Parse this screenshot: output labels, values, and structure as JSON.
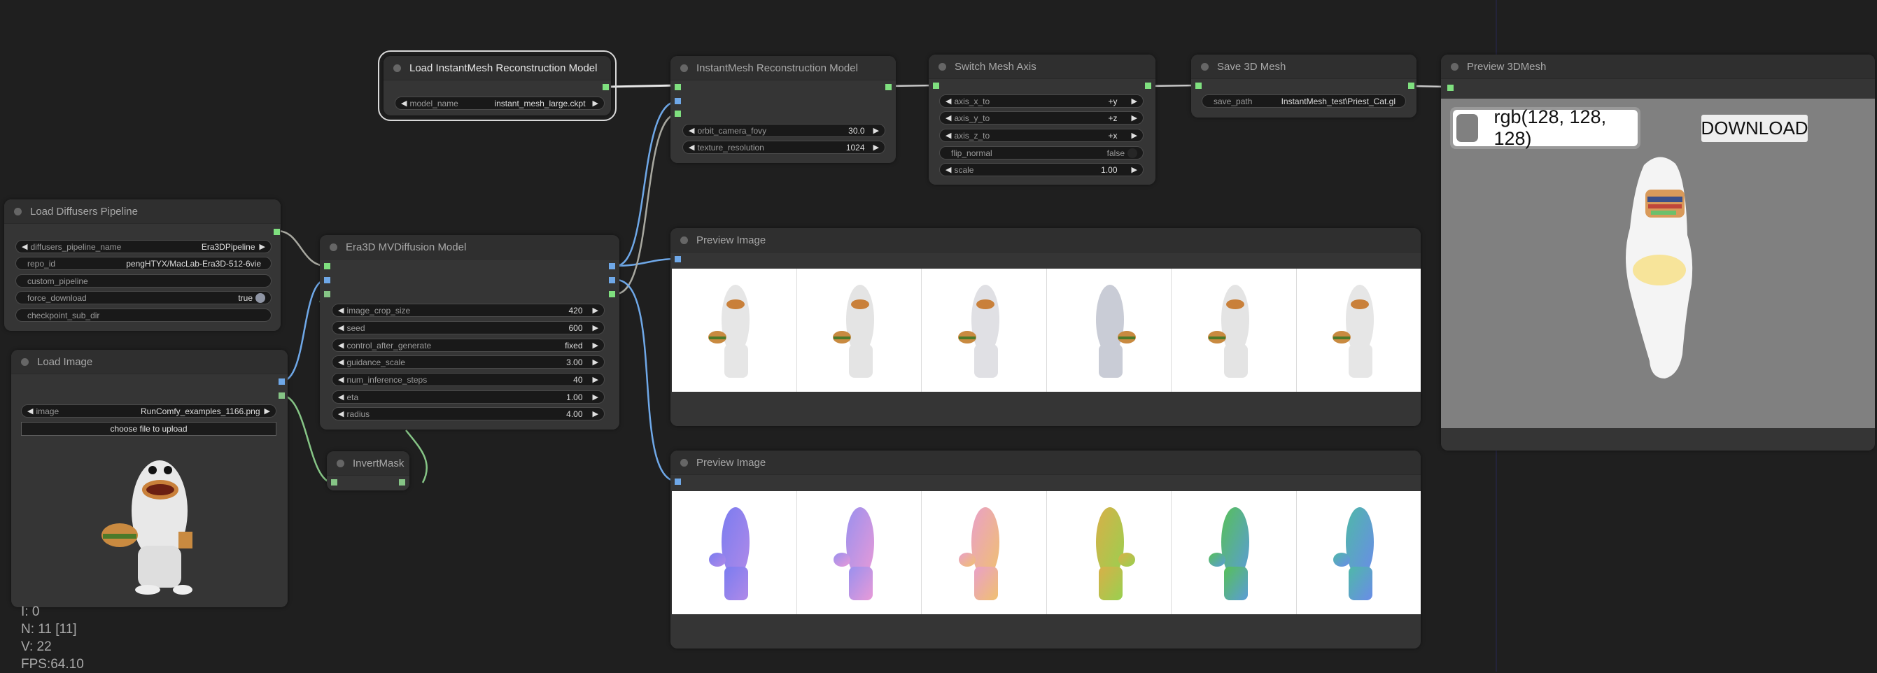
{
  "nodes": {
    "load_diffusers": {
      "title": "Load Diffusers Pipeline",
      "widgets": [
        {
          "label": "diffusers_pipeline_name",
          "value": "Era3DPipeline"
        },
        {
          "label": "repo_id",
          "value": "pengHTYX/MacLab-Era3D-512-6vie"
        },
        {
          "label": "custom_pipeline",
          "value": ""
        },
        {
          "label": "force_download",
          "value": "true"
        },
        {
          "label": "checkpoint_sub_dir",
          "value": ""
        }
      ]
    },
    "load_image": {
      "title": "Load Image",
      "widgets": [
        {
          "label": "image",
          "value": "RunComfy_examples_1166.png"
        }
      ],
      "upload_label": "choose file to upload"
    },
    "era3d": {
      "title": "Era3D MVDiffusion Model",
      "widgets": [
        {
          "label": "image_crop_size",
          "value": "420"
        },
        {
          "label": "seed",
          "value": "600"
        },
        {
          "label": "control_after_generate",
          "value": "fixed"
        },
        {
          "label": "guidance_scale",
          "value": "3.00"
        },
        {
          "label": "num_inference_steps",
          "value": "40"
        },
        {
          "label": "eta",
          "value": "1.00"
        },
        {
          "label": "radius",
          "value": "4.00"
        }
      ]
    },
    "invert_mask": {
      "title": "InvertMask"
    },
    "load_instantmesh": {
      "title": "Load InstantMesh Reconstruction Model",
      "widgets": [
        {
          "label": "model_name",
          "value": "instant_mesh_large.ckpt"
        }
      ]
    },
    "instantmesh": {
      "title": "InstantMesh Reconstruction Model",
      "widgets": [
        {
          "label": "orbit_camera_fovy",
          "value": "30.0"
        },
        {
          "label": "texture_resolution",
          "value": "1024"
        }
      ]
    },
    "switch_axis": {
      "title": "Switch Mesh Axis",
      "widgets": [
        {
          "label": "axis_x_to",
          "value": "+y"
        },
        {
          "label": "axis_y_to",
          "value": "+z"
        },
        {
          "label": "axis_z_to",
          "value": "+x"
        },
        {
          "label": "flip_normal",
          "value": "false"
        },
        {
          "label": "scale",
          "value": "1.00"
        }
      ]
    },
    "save_mesh": {
      "title": "Save 3D Mesh",
      "widgets": [
        {
          "label": "save_path",
          "value": "InstantMesh_test\\Priest_Cat.gl"
        }
      ]
    },
    "preview_rgb": {
      "title": "Preview Image",
      "image_count": 6
    },
    "preview_normal": {
      "title": "Preview Image",
      "image_count": 6
    },
    "preview_3d": {
      "title": "Preview 3DMesh",
      "color_label": "rgb(128, 128, 128)",
      "download_label": "DOWNLOAD",
      "background_color": "#808080"
    }
  },
  "stats": {
    "i": "I: 0",
    "n": "N: 11 [11]",
    "v": "V: 22",
    "fps": "FPS:64.10"
  },
  "colors": {
    "canvas": "#1f1f1f",
    "node": "#353535",
    "slot_image": "#6fa8e8",
    "slot_other": "#7fe07f",
    "link_image": "#6fa8e8",
    "link_mask": "#86c586",
    "link_other": "#a8a8a0",
    "link_model": "#e8e8e8"
  }
}
